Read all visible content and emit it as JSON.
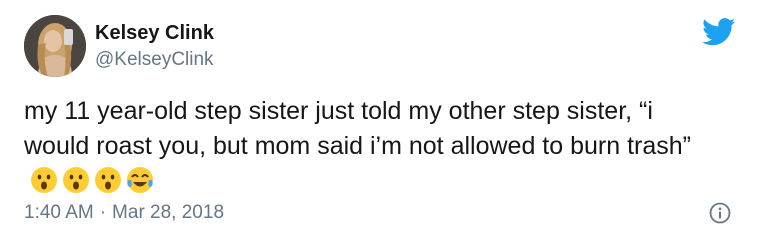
{
  "author": {
    "display_name": "Kelsey Clink",
    "handle": "@KelseyClink"
  },
  "tweet": {
    "text": "my 11 year-old step sister just told my other step sister, “i would roast you, but mom said i’m not allowed to burn trash”",
    "emojis": [
      "hushed-face-emoji",
      "hushed-face-emoji",
      "hushed-face-emoji",
      "tears-of-joy-emoji"
    ],
    "time": "1:40 AM",
    "separator": "·",
    "date": "Mar 28, 2018"
  },
  "icons": {
    "brand": "twitter-bird-icon",
    "info": "info-icon"
  },
  "colors": {
    "twitter_blue": "#1da1f2",
    "secondary_text": "#657786",
    "primary_text": "#14171a"
  }
}
